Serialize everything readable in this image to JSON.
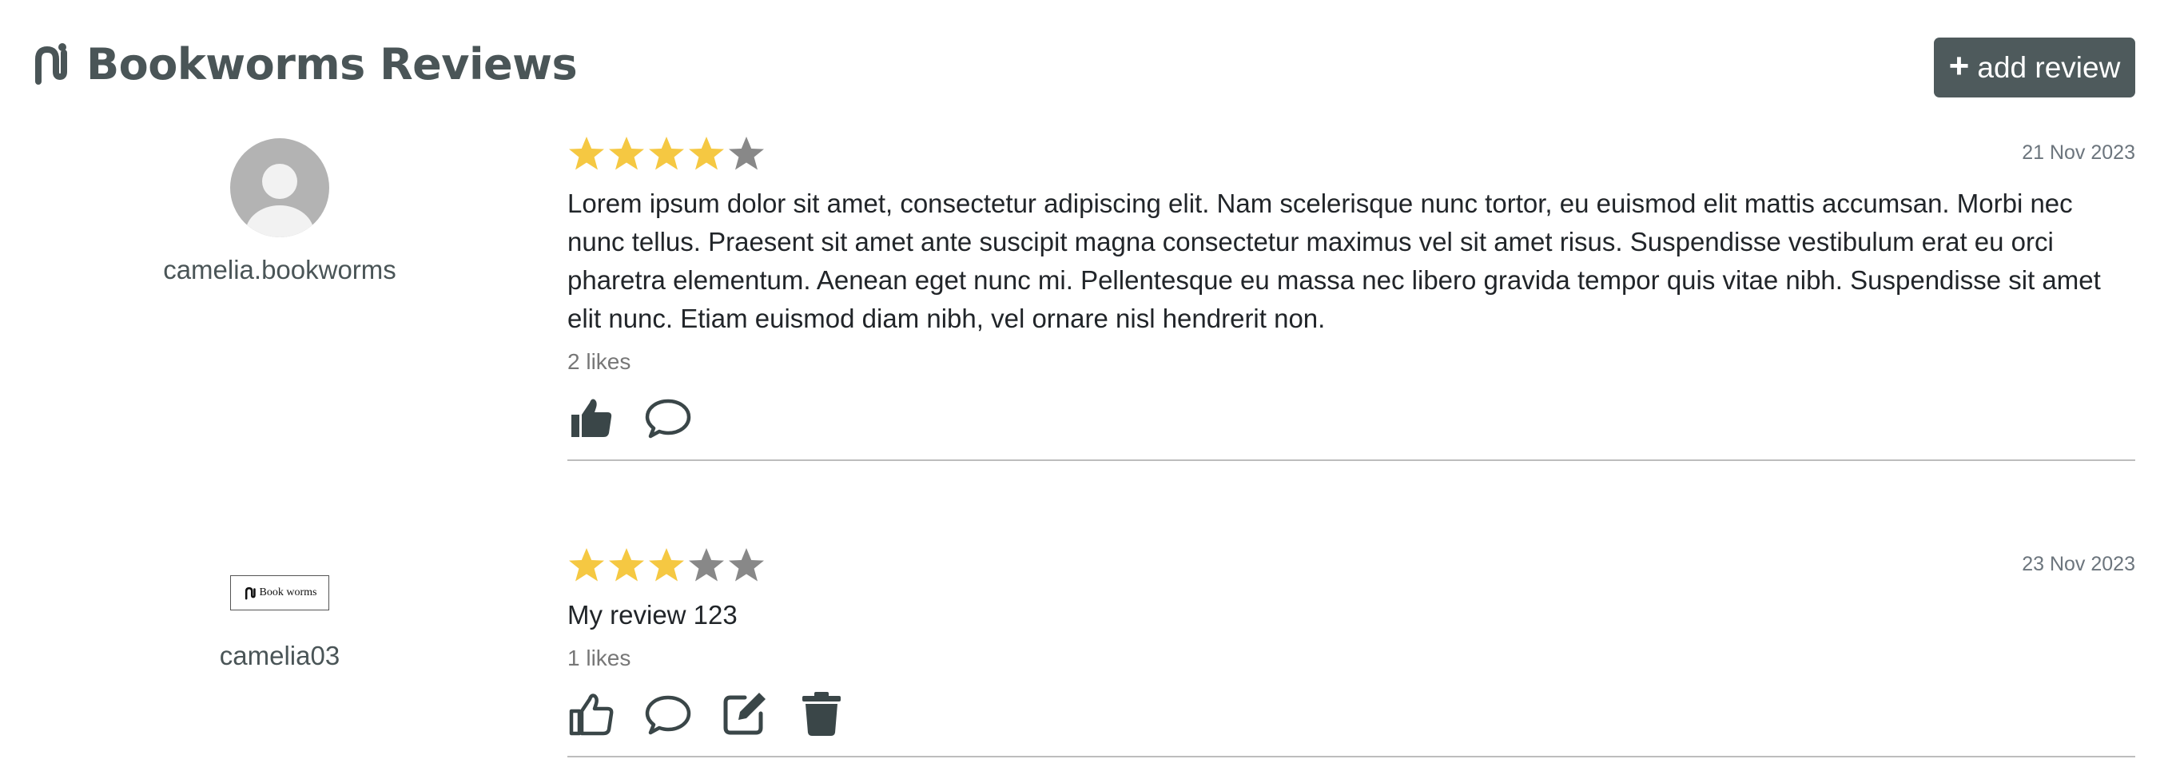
{
  "header": {
    "title": "Bookworms Reviews",
    "add_button_label": "add review",
    "logo_icon": "bookworm-logo-icon"
  },
  "colors": {
    "star_filled": "#f5c842",
    "star_empty": "#888888",
    "button_bg": "#4e5a5c",
    "icon_color": "#3a4648"
  },
  "reviews": [
    {
      "username": "camelia.bookworms",
      "avatar": "default-avatar",
      "rating": 4,
      "max_rating": 5,
      "date": "21 Nov 2023",
      "text": "Lorem ipsum dolor sit amet, consectetur adipiscing elit. Nam scelerisque nunc tortor, eu euismod elit mattis accumsan. Morbi nec nunc tellus. Praesent sit amet ante suscipit magna consectetur maximus vel sit amet risus. Suspendisse vestibulum erat eu orci pharetra elementum. Aenean eget nunc mi. Pellentesque eu massa nec libero gravida tempor quis vitae nibh. Suspendisse sit amet elit nunc. Etiam euismod diam nibh, vel ornare nisl hendrerit non.",
      "likes": "2 likes",
      "liked": true,
      "actions": [
        "like-icon",
        "comment-icon"
      ]
    },
    {
      "username": "camelia03",
      "avatar": "bookworms-logo-avatar",
      "avatar_text": "Book worms",
      "rating": 3,
      "max_rating": 5,
      "date": "23 Nov 2023",
      "text": "My review 123",
      "likes": "1 likes",
      "liked": false,
      "actions": [
        "like-icon",
        "comment-icon",
        "edit-icon",
        "delete-icon"
      ]
    }
  ]
}
